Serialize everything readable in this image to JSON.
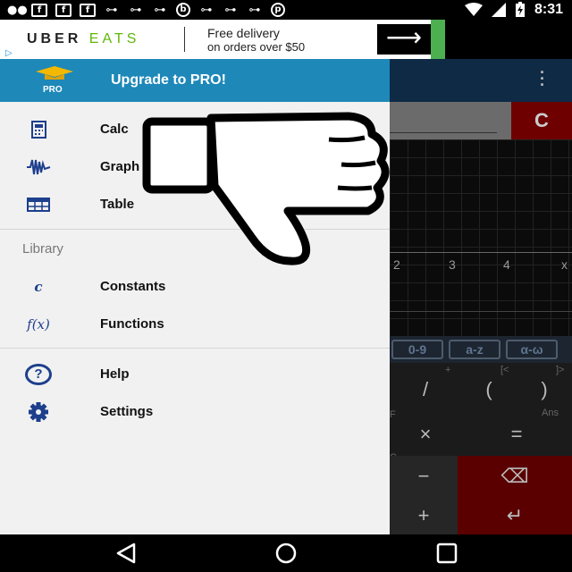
{
  "status_bar": {
    "left_icons": [
      "message-icon",
      "facebook-icon",
      "facebook-icon",
      "facebook-icon",
      "game-icon",
      "game-icon",
      "game-icon",
      "podcast-icon",
      "game-icon",
      "game-icon",
      "game-icon",
      "pinterest-icon"
    ],
    "time": "8:31"
  },
  "ad": {
    "brand_uber": "UBER",
    "brand_eats": "EATS",
    "line1": "Free delivery",
    "line2": "on orders over $50",
    "cta_icon": "arrow-right-icon",
    "colors": {
      "eats": "#5fb709",
      "cta_bg": "#000000",
      "accent_bar": "#4caf50"
    }
  },
  "drawer": {
    "header_label": "Upgrade to PRO!",
    "logo_text": "PRO",
    "header_color": "#1e88b8",
    "main_items": [
      {
        "label": "Calc",
        "icon": "calculator-icon"
      },
      {
        "label": "Graph",
        "icon": "graph-icon"
      },
      {
        "label": "Table",
        "icon": "table-icon"
      }
    ],
    "library_label": "Library",
    "library_items": [
      {
        "label": "Constants",
        "icon": "constant-c-icon",
        "glyph": "c"
      },
      {
        "label": "Functions",
        "icon": "function-fx-icon",
        "glyph": "f(x)"
      }
    ],
    "other_items": [
      {
        "label": "Help",
        "icon": "help-icon",
        "glyph": "?"
      },
      {
        "label": "Settings",
        "icon": "gear-icon"
      }
    ]
  },
  "background_app": {
    "clear_key": "C",
    "graph_ticks": [
      "2",
      "3",
      "4",
      "x"
    ],
    "keyboard_tabs": [
      "0-9",
      "a-z",
      "α-ω"
    ],
    "keys": {
      "divide": "/",
      "open_paren": "(",
      "close_paren": ")",
      "multiply": "×",
      "equals": "=",
      "minus": "−",
      "backspace_icon": "backspace-icon",
      "plus": "+",
      "enter_icon": "enter-icon"
    },
    "key_hints": {
      "plus_top": "+",
      "bracket_open": "[<",
      "bracket_close": "]>",
      "ans": "Ans",
      "f": "F",
      "c": "C"
    }
  },
  "overlay": {
    "icon": "thumbs-down-icon"
  },
  "nav_bar": {
    "back_icon": "back-triangle-icon",
    "home_icon": "home-circle-icon",
    "recents_icon": "recents-square-icon"
  }
}
